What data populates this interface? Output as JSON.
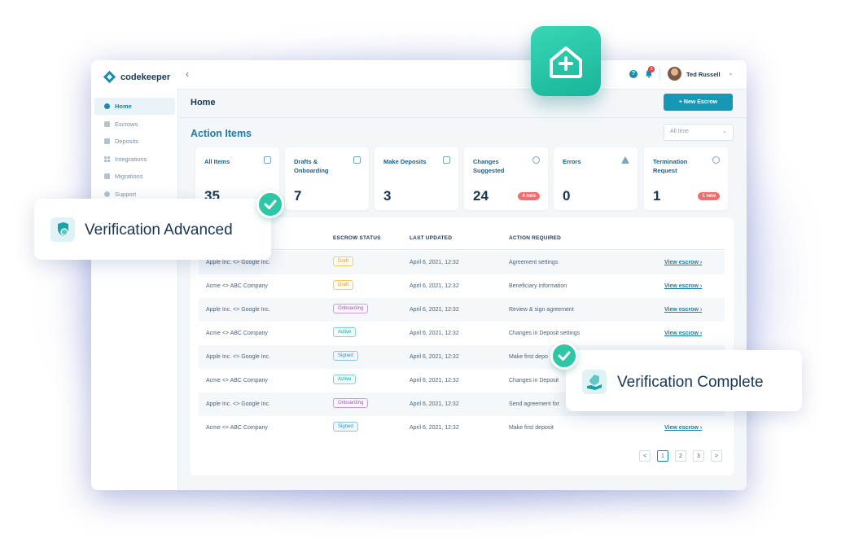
{
  "sidebar": {
    "brand": "codekeeper",
    "items": [
      {
        "label": "Home",
        "icon": "home-icon"
      },
      {
        "label": "Escrows",
        "icon": "document-icon"
      },
      {
        "label": "Deposits",
        "icon": "stack-icon"
      },
      {
        "label": "Integrations",
        "icon": "grid-icon"
      },
      {
        "label": "Migrations",
        "icon": "document-icon"
      },
      {
        "label": "Support",
        "icon": "support-icon"
      }
    ]
  },
  "topbar": {
    "collapse_icon": "chevron-left-icon",
    "notification_count": "3",
    "user_name": "Ted Russell"
  },
  "header": {
    "page_title": "Home",
    "new_escrow_label": "+ New Escrow",
    "section_title": "Action Items",
    "filter_value": "All time"
  },
  "cards": [
    {
      "label": "All Items",
      "value": "35",
      "badge": "",
      "icon": "list-icon"
    },
    {
      "label": "Drafts & Onboarding",
      "value": "7",
      "badge": "",
      "icon": "edit-icon"
    },
    {
      "label": "Make Deposits",
      "value": "3",
      "badge": "",
      "icon": "folder-icon"
    },
    {
      "label": "Changes Suggested",
      "value": "24",
      "badge": "4 new",
      "icon": "gear-icon"
    },
    {
      "label": "Errors",
      "value": "0",
      "badge": "",
      "icon": "warning-icon"
    },
    {
      "label": "Termination Request",
      "value": "1",
      "badge": "1 new",
      "icon": "close-circle-icon"
    }
  ],
  "table": {
    "headers": [
      "ESCROW STATUS",
      "LAST UPDATED",
      "ACTION REQUIRED"
    ],
    "rows": [
      {
        "parties": "Apple Inc. <> Google Inc.",
        "status": "Draft",
        "updated": "April 6, 2021, 12:32",
        "action": "Agreement settings",
        "link": "View escrow"
      },
      {
        "parties": "Acme <> ABC Company",
        "status": "Draft",
        "updated": "April 6, 2021, 12:32",
        "action": "Beneficiary information",
        "link": "View escrow"
      },
      {
        "parties": "Apple Inc. <> Google Inc.",
        "status": "Onboarding",
        "updated": "April 6, 2021, 12:32",
        "action": "Review & sign agreement",
        "link": "View escrow"
      },
      {
        "parties": "Acme <> ABC Company",
        "status": "Active",
        "updated": "April 6, 2021, 12:32",
        "action": "Changes in Deposit settings",
        "link": "View escrow"
      },
      {
        "parties": "Apple Inc. <> Google Inc.",
        "status": "Signed",
        "updated": "April 6, 2021, 12:32",
        "action": "Make first depo",
        "link": ""
      },
      {
        "parties": "Acme <> ABC Company",
        "status": "Active",
        "updated": "April 6, 2021, 12:32",
        "action": "Changes in Deposit",
        "link": ""
      },
      {
        "parties": "Apple Inc. <> Google Inc.",
        "status": "Onboarding",
        "updated": "April 6, 2021, 12:32",
        "action": "Send agreement for",
        "link": ""
      },
      {
        "parties": "Acme <> ABC Company",
        "status": "Signed",
        "updated": "April 6, 2021, 12:32",
        "action": "Make first deposit",
        "link": "View escrow"
      }
    ]
  },
  "pagination": {
    "prev": "<",
    "pages": [
      "1",
      "2",
      "3"
    ],
    "next": ">",
    "current": "1"
  },
  "overlays": {
    "verification_advanced": "Verification Advanced",
    "verification_complete": "Verification Complete"
  },
  "colors": {
    "accent": "#1797b6",
    "teal": "#2dc7a5",
    "badge_red": "#f26d6d"
  }
}
